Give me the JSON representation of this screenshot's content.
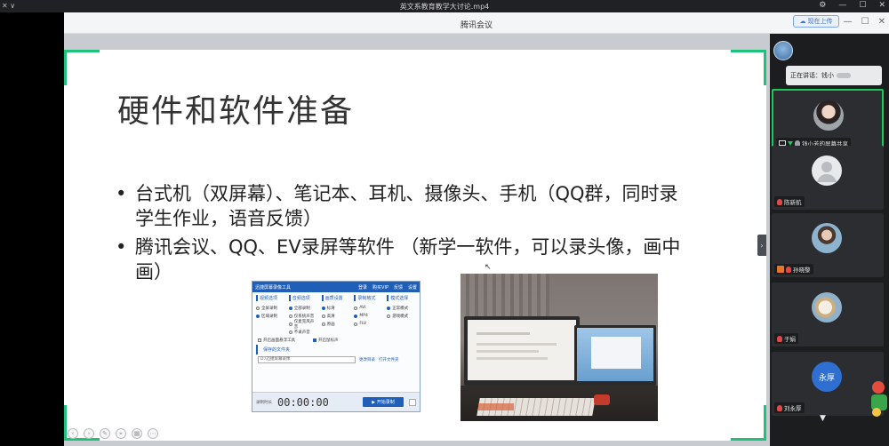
{
  "player": {
    "left_label": "✕  ∨",
    "file_title": "英文系教育教学大讨论.mp4"
  },
  "meeting": {
    "app_title": "腾讯会议",
    "upload_label": "现在上传"
  },
  "slide": {
    "title": "硬件和软件准备",
    "bullets": [
      "台式机（双屏幕）、笔记本、耳机、摄像头、手机（QQ群，同时录学生作业，语音反馈）",
      "腾讯会议、QQ、EV录屏等软件 （新学一软件，可以录头像，画中画）"
    ]
  },
  "recorder": {
    "app_name": "迅捷屏幕录像工具",
    "login": "登录",
    "buy": "购买VIP",
    "feedback": "反馈",
    "settings": "设置",
    "columns": [
      {
        "header": "视频选项",
        "options": [
          {
            "label": "全屏录制",
            "on": false
          },
          {
            "label": "区域录制",
            "on": true
          }
        ]
      },
      {
        "header": "音频选项",
        "options": [
          {
            "label": "全部录制",
            "on": true
          },
          {
            "label": "仅系统声音",
            "on": false
          },
          {
            "label": "仅麦克风声音",
            "on": false
          },
          {
            "label": "不录声音",
            "on": false
          }
        ]
      },
      {
        "header": "画质设置",
        "options": [
          {
            "label": "标清",
            "on": true
          },
          {
            "label": "高清",
            "on": false
          },
          {
            "label": "原画",
            "on": false
          }
        ]
      },
      {
        "header": "录制格式",
        "options": [
          {
            "label": "AVI",
            "on": false
          },
          {
            "label": "MP4",
            "on": true
          },
          {
            "label": "FLV",
            "on": false
          }
        ]
      },
      {
        "header": "模式选择",
        "options": [
          {
            "label": "正常模式",
            "on": true
          },
          {
            "label": "游戏模式",
            "on": false
          }
        ]
      }
    ],
    "check1": "开启画面悬浮工具",
    "check2": "开启鼠标声",
    "save_label": "保存的文件夹",
    "save_path": "D:\\迅捷屏幕录像",
    "change_dir": "更改目录",
    "open_dir": "打开文件夹",
    "duration_label": "录制时长",
    "timer": "00:00:00",
    "start_label": "开始录制"
  },
  "speaking": {
    "label": "正在讲话：钱小"
  },
  "participants": [
    {
      "name": "钱小芳的屏幕共享",
      "active": true,
      "avatar": "photo-woman"
    },
    {
      "name": "陈新航",
      "active": false,
      "avatar": "default"
    },
    {
      "name": "孙晓黎",
      "active": false,
      "avatar": "photo-girl"
    },
    {
      "name": "于娟",
      "active": false,
      "avatar": "photo-horse"
    },
    {
      "name": "刘永厚",
      "active": false,
      "avatar": "text",
      "avatar_text": "永厚"
    }
  ],
  "colors": {
    "accent_green": "#22c55e",
    "slide_corner_green": "#1ec27a",
    "sidebar_bg": "#1c1d1f",
    "recorder_blue": "#1f5fb8"
  }
}
